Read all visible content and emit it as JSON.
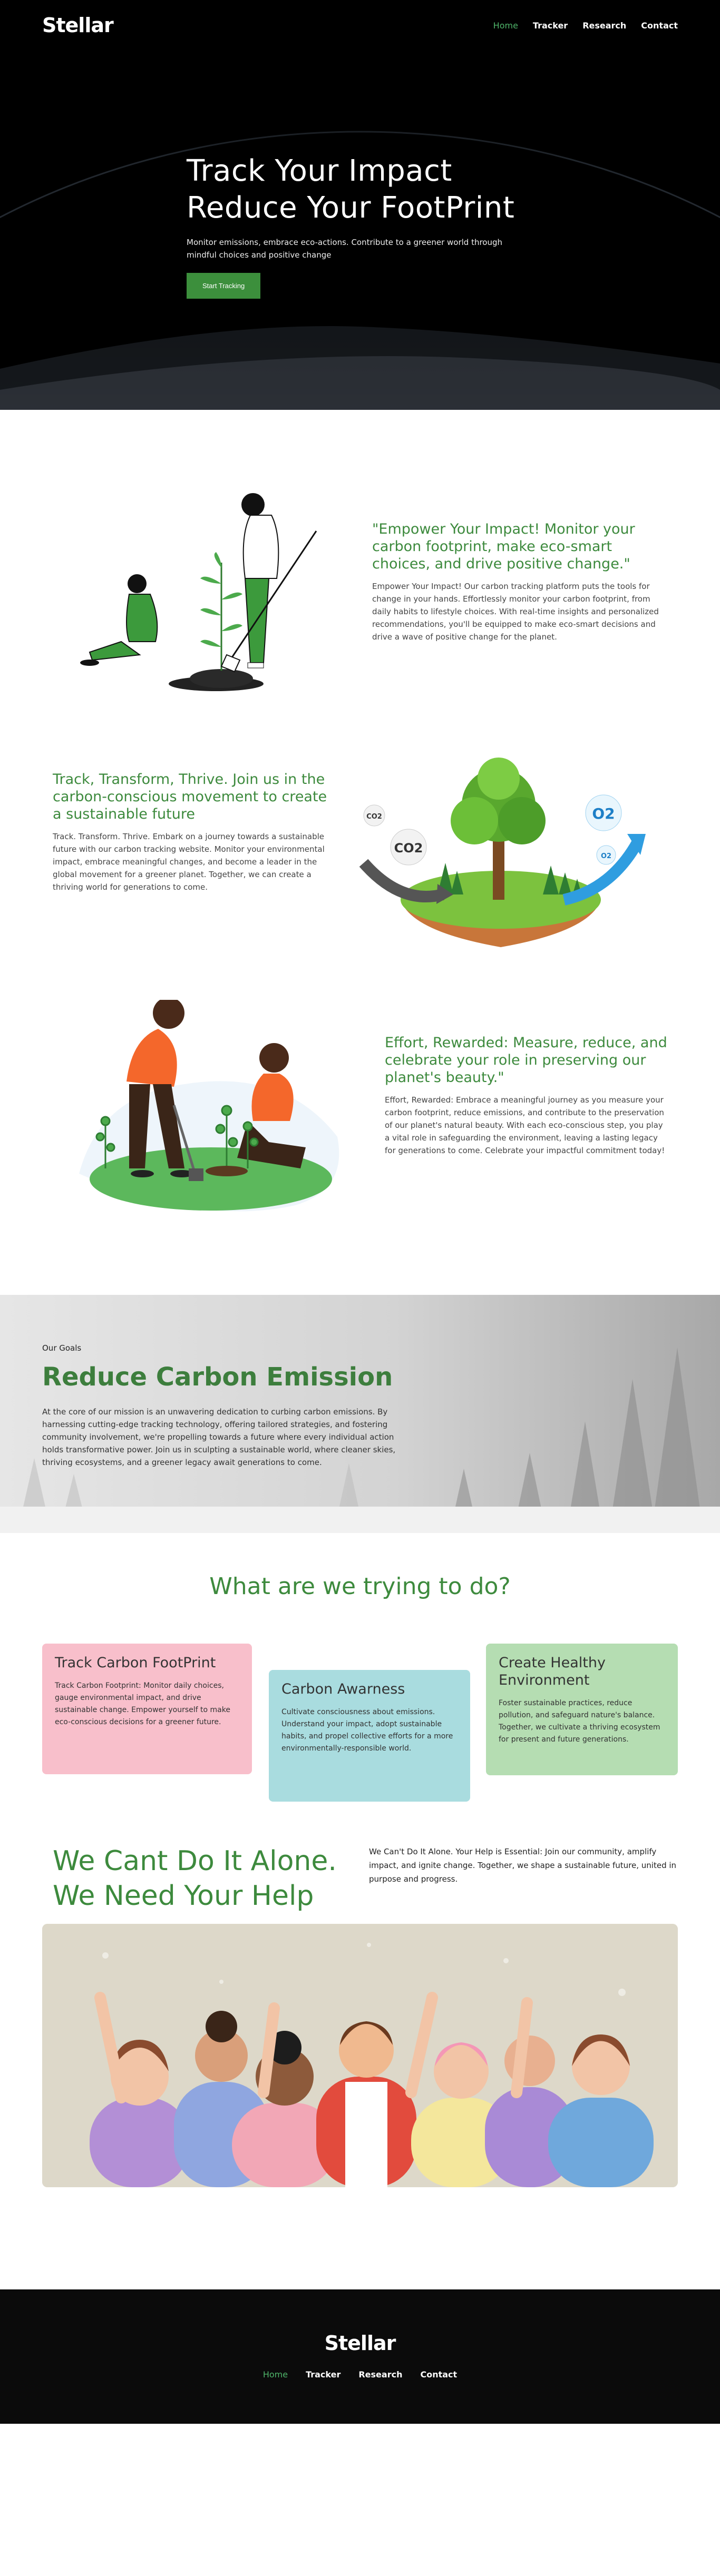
{
  "brand": {
    "name": "Stellar",
    "accent": "#3c8f3c",
    "active_link": "#4fb56a"
  },
  "nav": {
    "items": [
      {
        "label": "Home",
        "active": true
      },
      {
        "label": "Tracker",
        "active": false
      },
      {
        "label": "Research",
        "active": false
      },
      {
        "label": "Contact",
        "active": false
      }
    ]
  },
  "hero": {
    "title_line1": "Track Your Impact",
    "title_line2": "Reduce Your FootPrint",
    "subtitle": "Monitor emissions, embrace eco-actions. Contribute to a greener world through mindful choices and positive change",
    "button": "Start Tracking"
  },
  "features": [
    {
      "title": "\"Empower Your Impact! Monitor your carbon footprint, make eco-smart choices, and drive positive change.\"",
      "body": "Empower Your Impact! Our carbon tracking platform puts the tools for change in your hands. Effortlessly monitor your carbon footprint, from daily habits to lifestyle choices. With real-time insights and personalized recommendations, you'll be equipped to make eco-smart decisions and drive a wave of positive change for the planet."
    },
    {
      "title": "Track, Transform, Thrive. Join us in the carbon-conscious movement to create a sustainable future",
      "body": "Track. Transform. Thrive. Embark on a journey towards a sustainable future with our carbon tracking website. Monitor your environmental impact, embrace meaningful changes, and become a leader in the global movement for a greener planet. Together, we can create a thriving world for generations to come."
    },
    {
      "title": "Effort, Rewarded: Measure, reduce, and celebrate your role in preserving our planet's beauty.\"",
      "body": "Effort, Rewarded: Embrace a meaningful journey as you measure your carbon footprint, reduce emissions, and contribute to the preservation of our planet's natural beauty. With each eco-conscious step, you play a vital role in safeguarding the environment, leaving a lasting legacy for generations to come. Celebrate your impactful commitment today!"
    }
  ],
  "illustration_labels": {
    "co2_big": "CO2",
    "co2_small": "CO2",
    "o2_big": "O2",
    "o2_small": "O2"
  },
  "goals": {
    "kicker": "Our Goals",
    "title": "Reduce Carbon Emission",
    "body": "At the core of our mission is an unwavering dedication to curbing carbon emissions. By harnessing cutting-edge tracking technology, offering tailored strategies, and fostering community involvement, we're propelling towards a future where every individual action holds transformative power. Join us in sculpting a sustainable world, where cleaner skies, thriving ecosystems, and a greener legacy await generations to come."
  },
  "trying": {
    "title": "What are we trying to do?",
    "cards": [
      {
        "title": "Track Carbon FootPrint",
        "body": "Track Carbon Footprint: Monitor daily choices, gauge environmental impact, and drive sustainable change. Empower yourself to make eco-conscious decisions for a greener future.",
        "color": "#f8bfcb"
      },
      {
        "title": "Carbon Awarness",
        "body": "Cultivate consciousness about emissions. Understand your impact, adopt sustainable habits, and propel collective efforts for a more environmentally-responsible world.",
        "color": "#a9dcdf"
      },
      {
        "title": "Create Healthy Environment",
        "body": "Foster sustainable practices, reduce pollution, and safeguard nature's balance. Together, we cultivate a thriving ecosystem for present and future generations.",
        "color": "#b5ddb2"
      }
    ]
  },
  "help": {
    "title_line1": "We Cant Do It Alone.",
    "title_line2": "We Need Your Help",
    "body": "We Can't Do It Alone. Your Help is Essential: Join our community, amplify impact, and ignite change. Together, we shape a sustainable future, united in purpose and progress."
  },
  "footer": {
    "name": "Stellar"
  },
  "icons": [
    "earth-horizon-image",
    "planting-illustration",
    "co2-island-illustration",
    "watering-illustration",
    "crowd-illustration"
  ]
}
